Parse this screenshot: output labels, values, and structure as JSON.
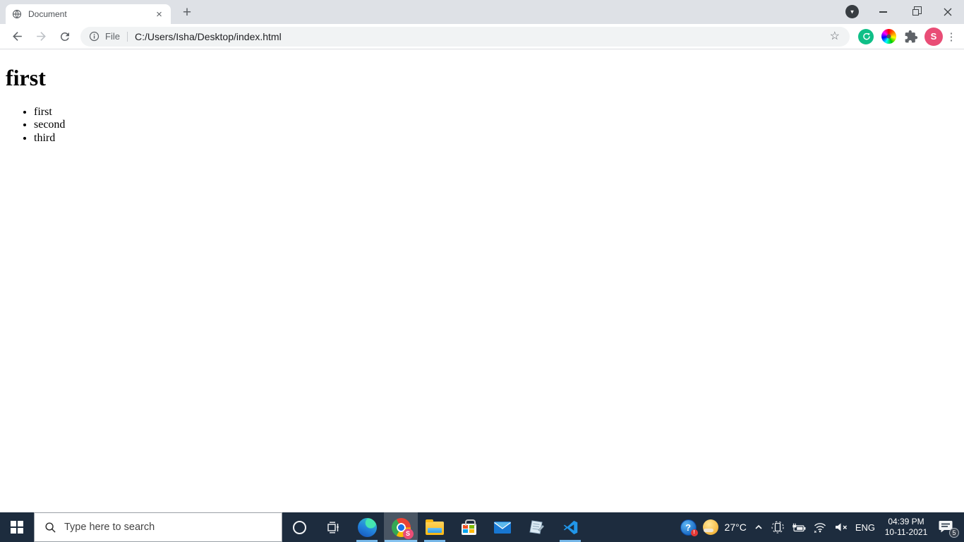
{
  "browser": {
    "tab": {
      "title": "Document"
    },
    "glyphs": {
      "tab_close": "×",
      "new_tab": "+",
      "chevron_down": "▾",
      "bookmark_star": "☆",
      "overflow_menu": "⋮"
    },
    "toolbar": {
      "scheme_label": "File",
      "url": "C:/Users/Isha/Desktop/index.html"
    },
    "profile": {
      "initial": "S"
    }
  },
  "page": {
    "heading": "first",
    "list": [
      "first",
      "second",
      "third"
    ]
  },
  "taskbar": {
    "search": {
      "placeholder": "Type here to search"
    },
    "apps": [
      "cortana",
      "task-view",
      "microsoft-edge",
      "google-chrome",
      "file-explorer",
      "microsoft-store",
      "mail",
      "notepad",
      "visual-studio-code"
    ],
    "chrome_profile_badge": "S",
    "tray": {
      "help_badge": "!",
      "temperature": "27°C",
      "language": "ENG",
      "time": "04:39 PM",
      "date": "10-11-2021",
      "notification_count": "5"
    }
  },
  "colors": {
    "taskbar_background": "#1d2c3e",
    "running_indicator": "#76b7e8",
    "tabstrip_background": "#dee1e6",
    "omnibox_background": "#f1f3f4",
    "avatar": "#e94d76",
    "sync_extension_green": "#0fbf87"
  }
}
